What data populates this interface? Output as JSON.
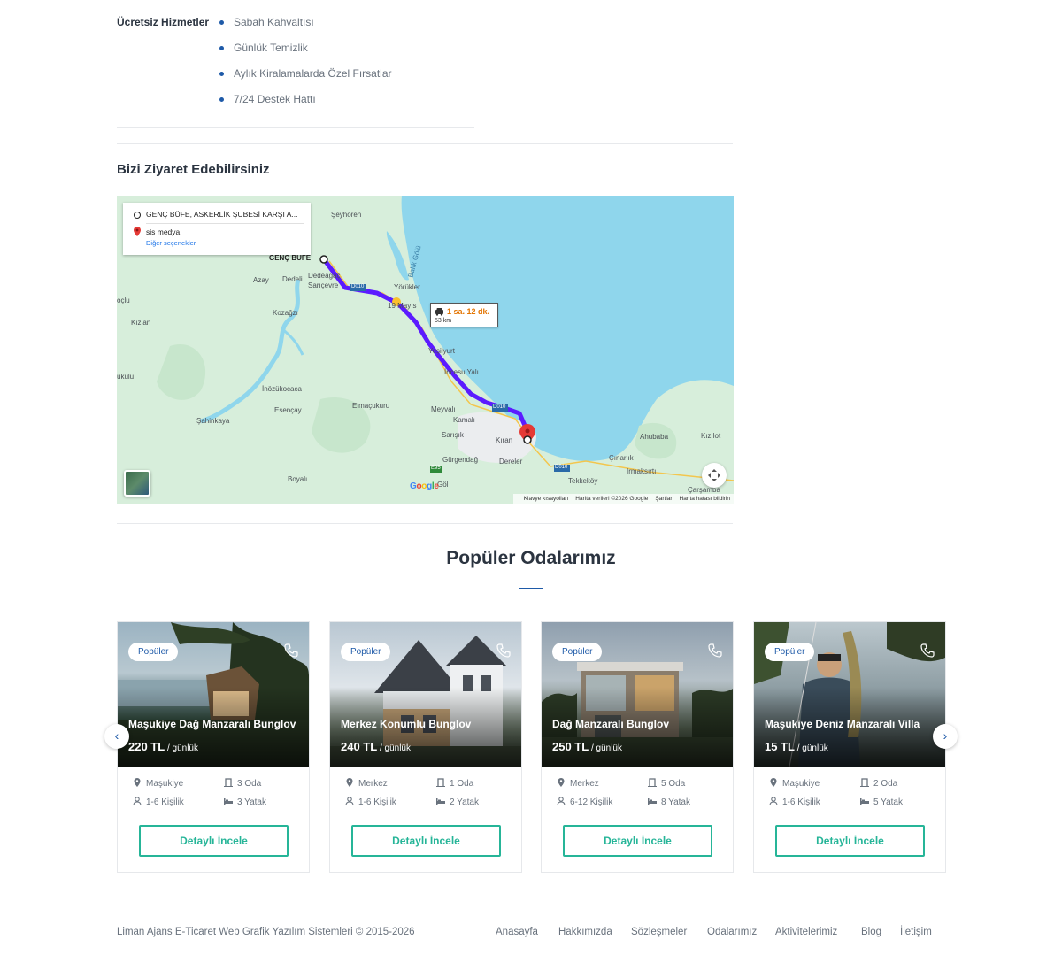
{
  "services": {
    "label": "Ücretsiz Hizmetler",
    "items": [
      "Sabah Kahvaltısı",
      "Günlük Temizlik",
      "Aylık Kiralamalarda Özel Fırsatlar",
      "7/24 Destek Hattı"
    ]
  },
  "visit": {
    "title": "Bizi Ziyaret Edebilirsiniz"
  },
  "map": {
    "from": "GENÇ BÜFE, ASKERLİK ŞUBESİ KARŞI A...",
    "to": "sis medya",
    "more_options": "Diğer seçenekler",
    "route_time": "1 sa. 12 dk.",
    "route_distance": "53 km",
    "labels": {
      "seyhoren": "Şeyhören",
      "genc_bufe": "GENÇ BÜFE",
      "azay": "Azay",
      "dedeli": "Dedeli",
      "dedeagac": "Dedeağaç",
      "saricevre": "Sarıçevre",
      "yorukler": "Yörükler",
      "balik_golu": "Balık Gölü",
      "oclu": "oçlu",
      "kizlan": "Kızlan",
      "kozagzi": "Kozağzı",
      "mayis": "19 Mayıs",
      "yesilyurt": "Yeşilyurt",
      "incesu": "İncesu Yalı",
      "bukul": "ükülü",
      "inozukocaca": "İnözükocaca",
      "esencay": "Esençay",
      "elmacukuru": "Elmaçukuru",
      "sahinkaya": "Şahinkaya",
      "meyvali": "Meyvalı",
      "kamali": "Kamalı",
      "sarisik": "Sarışık",
      "kiran": "Kıran",
      "gurgendag": "Gürgendağ",
      "dereler": "Dereler",
      "ahubaba": "Ahubaba",
      "kizilot": "Kızılot",
      "cinarlik": "Çınarlık",
      "irmaksiri": "Irmaksırtı",
      "tekkekoy": "Tekkeköy",
      "carsamba": "Çarşamba",
      "boyali": "Boyalı",
      "gol": "Göl",
      "d010a": "D010",
      "d010b": "D010",
      "d010c": "D010",
      "e95": "E95"
    },
    "footer": [
      "Klavye kısayolları",
      "Harita verileri ©2026 Google",
      "Şartlar",
      "Harita hatası bildirin"
    ],
    "google": "Google"
  },
  "popular": {
    "title": "Popüler Odalarımız",
    "badge": "Popüler",
    "per_day": " / günlük",
    "button": "Detaylı İncele",
    "rooms": [
      {
        "name": "Maşukiye Dağ Manzaralı Bunglov",
        "price": "220 TL",
        "location": "Maşukiye",
        "rooms": "3 Oda",
        "capacity": "1-6 Kişilik",
        "beds": "3 Yatak"
      },
      {
        "name": "Merkez Konumlu Bunglov",
        "price": "240 TL",
        "location": "Merkez",
        "rooms": "1 Oda",
        "capacity": "1-6 Kişilik",
        "beds": "2 Yatak"
      },
      {
        "name": "Dağ Manzaralı Bunglov",
        "price": "250 TL",
        "location": "Merkez",
        "rooms": "5 Oda",
        "capacity": "6-12 Kişilik",
        "beds": "8 Yatak"
      },
      {
        "name": "Maşukiye Deniz Manzaralı Villa",
        "price": "15 TL",
        "location": "Maşukiye",
        "rooms": "2 Oda",
        "capacity": "1-6 Kişilik",
        "beds": "5 Yatak"
      }
    ]
  },
  "footer": {
    "copyright": "Liman Ajans E-Ticaret Web Grafik Yazılım Sistemleri © 2015-2026",
    "nav": [
      "Anasayfa",
      "Hakkımızda",
      "Sözleşmeler",
      "Odalarımız",
      "Aktivitelerimiz",
      "Blog",
      "İletişim"
    ]
  },
  "colors": {
    "accent": "#1e5aa8",
    "button": "#26b598",
    "sea": "#8fd6ec",
    "land": "#d7eedb",
    "route": "#5b1bff"
  }
}
